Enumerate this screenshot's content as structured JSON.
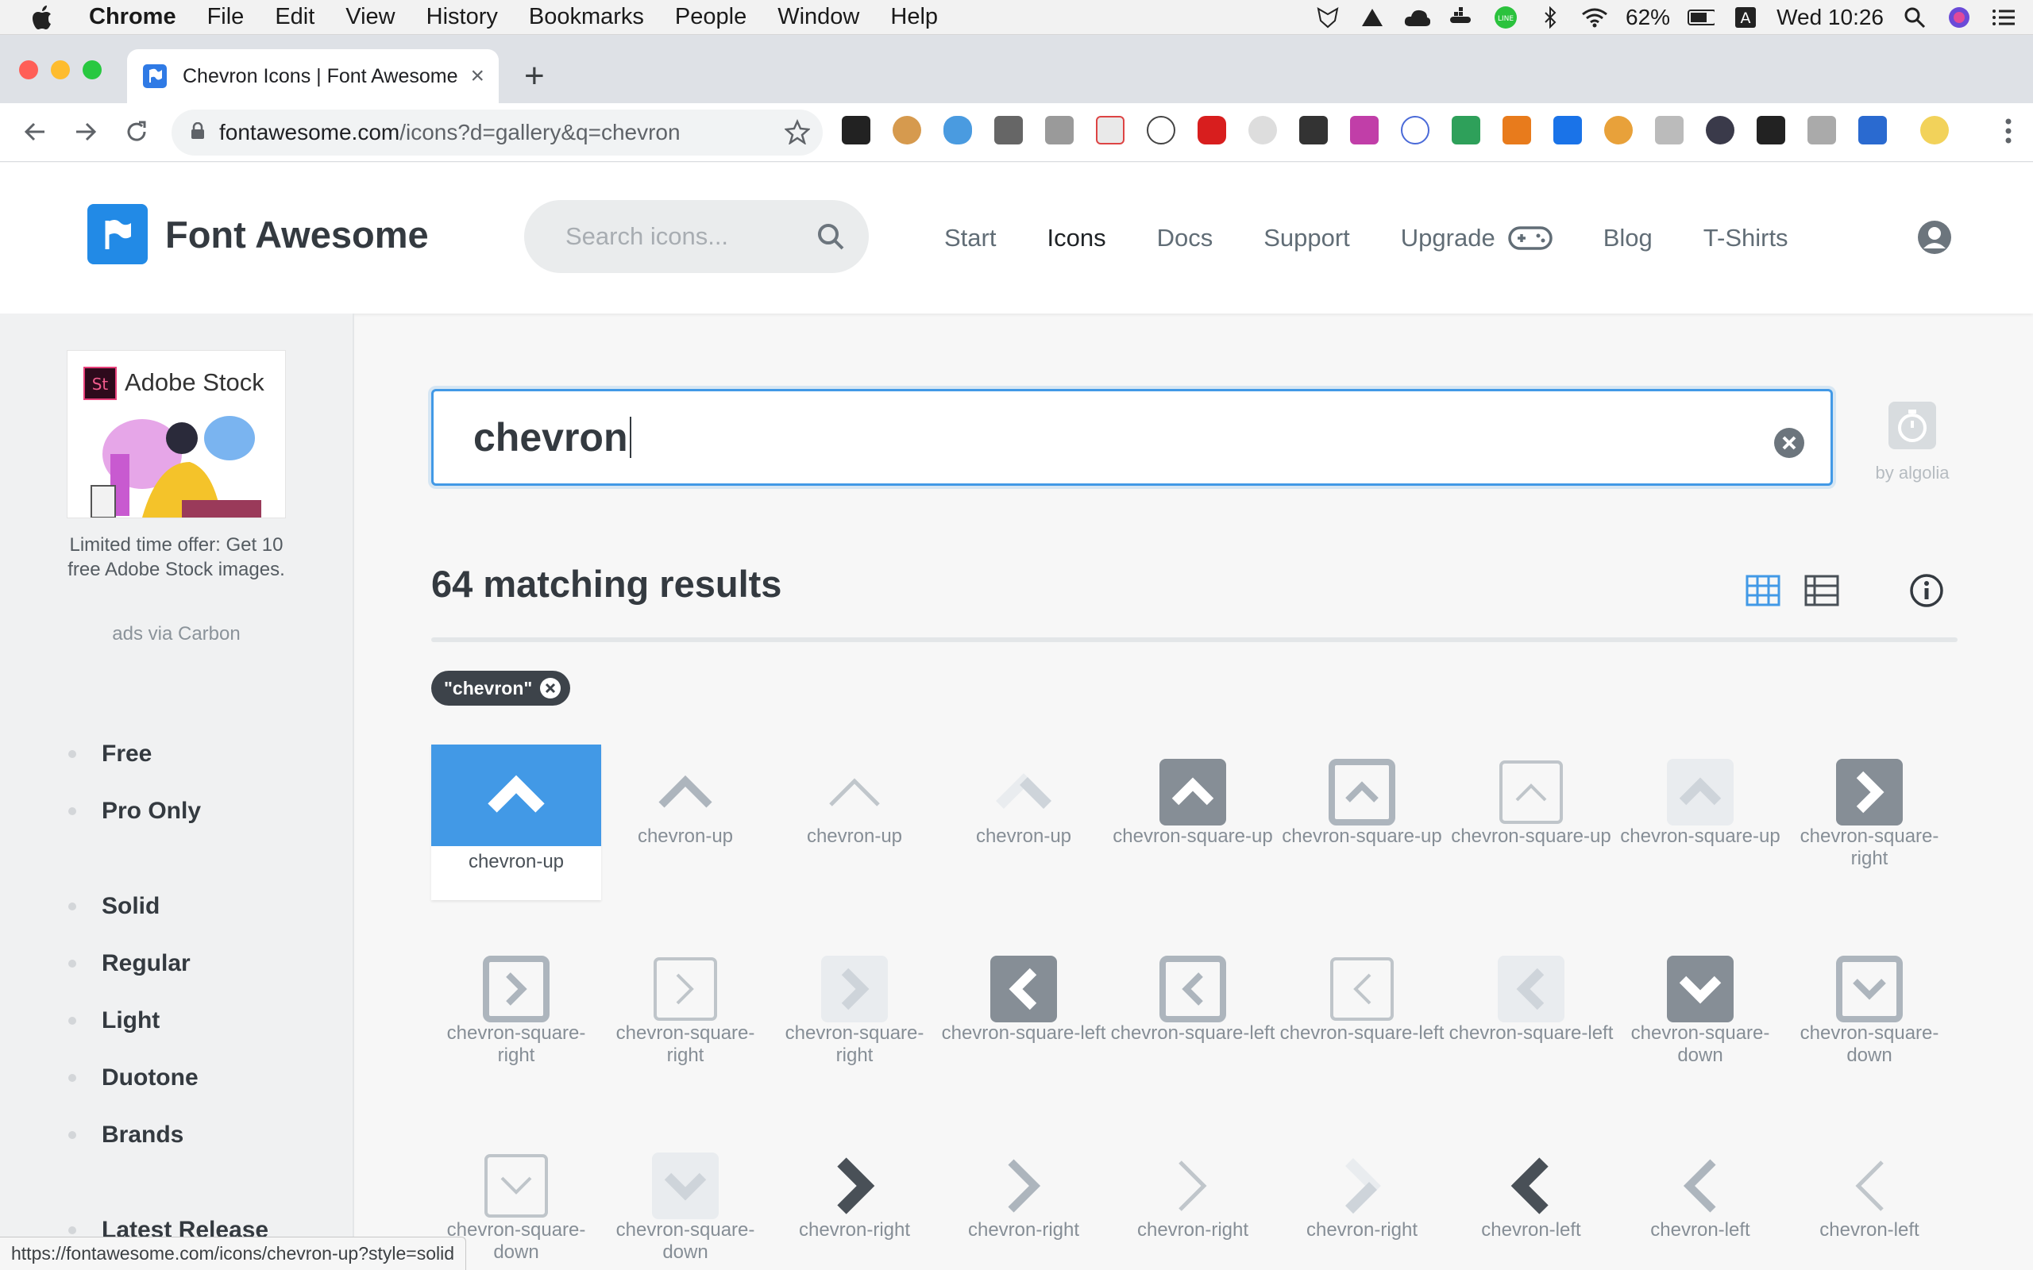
{
  "menubar": {
    "app": "Chrome",
    "items": [
      "File",
      "Edit",
      "View",
      "History",
      "Bookmarks",
      "People",
      "Window",
      "Help"
    ],
    "battery": "62%",
    "clock": "Wed 10:26",
    "input_source": "A"
  },
  "browser": {
    "tab_title": "Chevron Icons | Font Awesome",
    "tab_close": "×",
    "new_tab": "+",
    "url_host": "fontawesome.com",
    "url_path": "/icons?d=gallery&q=chevron"
  },
  "site": {
    "brand": "Font Awesome",
    "search_placeholder": "Search icons...",
    "nav": [
      "Start",
      "Icons",
      "Docs",
      "Support",
      "Upgrade",
      "Blog",
      "T-Shirts"
    ],
    "active_nav": "Icons"
  },
  "sidebar": {
    "ad_brand": "Adobe Stock",
    "ad_text": "Limited time offer: Get 10 free Adobe Stock images.",
    "ad_via": "ads via Carbon",
    "license_filters": [
      "Free",
      "Pro Only"
    ],
    "style_filters": [
      "Solid",
      "Regular",
      "Light",
      "Duotone",
      "Brands"
    ],
    "latest": "Latest Release"
  },
  "main": {
    "query": "chevron",
    "algolia": "by algolia",
    "results_text": "64 matching results",
    "chip_label": "\"chevron\"",
    "icons": [
      {
        "label": "chevron-up",
        "glyph": "chevron-up-icon",
        "style": "solid"
      },
      {
        "label": "chevron-up",
        "glyph": "chevron-up-icon",
        "style": "regular"
      },
      {
        "label": "chevron-up",
        "glyph": "chevron-up-icon",
        "style": "light"
      },
      {
        "label": "chevron-up",
        "glyph": "chevron-up-icon",
        "style": "duotone"
      },
      {
        "label": "chevron-square-up",
        "glyph": "chevron-square-up-icon",
        "style": "solid"
      },
      {
        "label": "chevron-square-up",
        "glyph": "chevron-square-up-icon",
        "style": "regular"
      },
      {
        "label": "chevron-square-up",
        "glyph": "chevron-square-up-icon",
        "style": "light"
      },
      {
        "label": "chevron-square-up",
        "glyph": "chevron-square-up-icon",
        "style": "duotone"
      },
      {
        "label": "chevron-square-right",
        "glyph": "chevron-square-right-icon",
        "style": "solid"
      },
      {
        "label": "chevron-square-right",
        "glyph": "chevron-square-right-icon",
        "style": "regular"
      },
      {
        "label": "chevron-square-right",
        "glyph": "chevron-square-right-icon",
        "style": "light"
      },
      {
        "label": "chevron-square-right",
        "glyph": "chevron-square-right-icon",
        "style": "duotone"
      },
      {
        "label": "chevron-square-left",
        "glyph": "chevron-square-left-icon",
        "style": "solid"
      },
      {
        "label": "chevron-square-left",
        "glyph": "chevron-square-left-icon",
        "style": "regular"
      },
      {
        "label": "chevron-square-left",
        "glyph": "chevron-square-left-icon",
        "style": "light"
      },
      {
        "label": "chevron-square-left",
        "glyph": "chevron-square-left-icon",
        "style": "duotone"
      },
      {
        "label": "chevron-square-down",
        "glyph": "chevron-square-down-icon",
        "style": "solid"
      },
      {
        "label": "chevron-square-down",
        "glyph": "chevron-square-down-icon",
        "style": "regular"
      },
      {
        "label": "chevron-square-down",
        "glyph": "chevron-square-down-icon",
        "style": "light"
      },
      {
        "label": "chevron-square-down",
        "glyph": "chevron-square-down-icon",
        "style": "duotone"
      },
      {
        "label": "chevron-right",
        "glyph": "chevron-right-icon",
        "style": "solid"
      },
      {
        "label": "chevron-right",
        "glyph": "chevron-right-icon",
        "style": "regular"
      },
      {
        "label": "chevron-right",
        "glyph": "chevron-right-icon",
        "style": "light"
      },
      {
        "label": "chevron-right",
        "glyph": "chevron-right-icon",
        "style": "duotone"
      },
      {
        "label": "chevron-left",
        "glyph": "chevron-left-icon",
        "style": "solid"
      },
      {
        "label": "chevron-left",
        "glyph": "chevron-left-icon",
        "style": "regular"
      },
      {
        "label": "chevron-left",
        "glyph": "chevron-left-icon",
        "style": "light"
      }
    ]
  },
  "status_url": "https://fontawesome.com/icons/chevron-up?style=solid",
  "colors": {
    "accent": "#4299e6",
    "brand": "#228ae6",
    "text": "#343a40",
    "muted": "#868e96"
  }
}
